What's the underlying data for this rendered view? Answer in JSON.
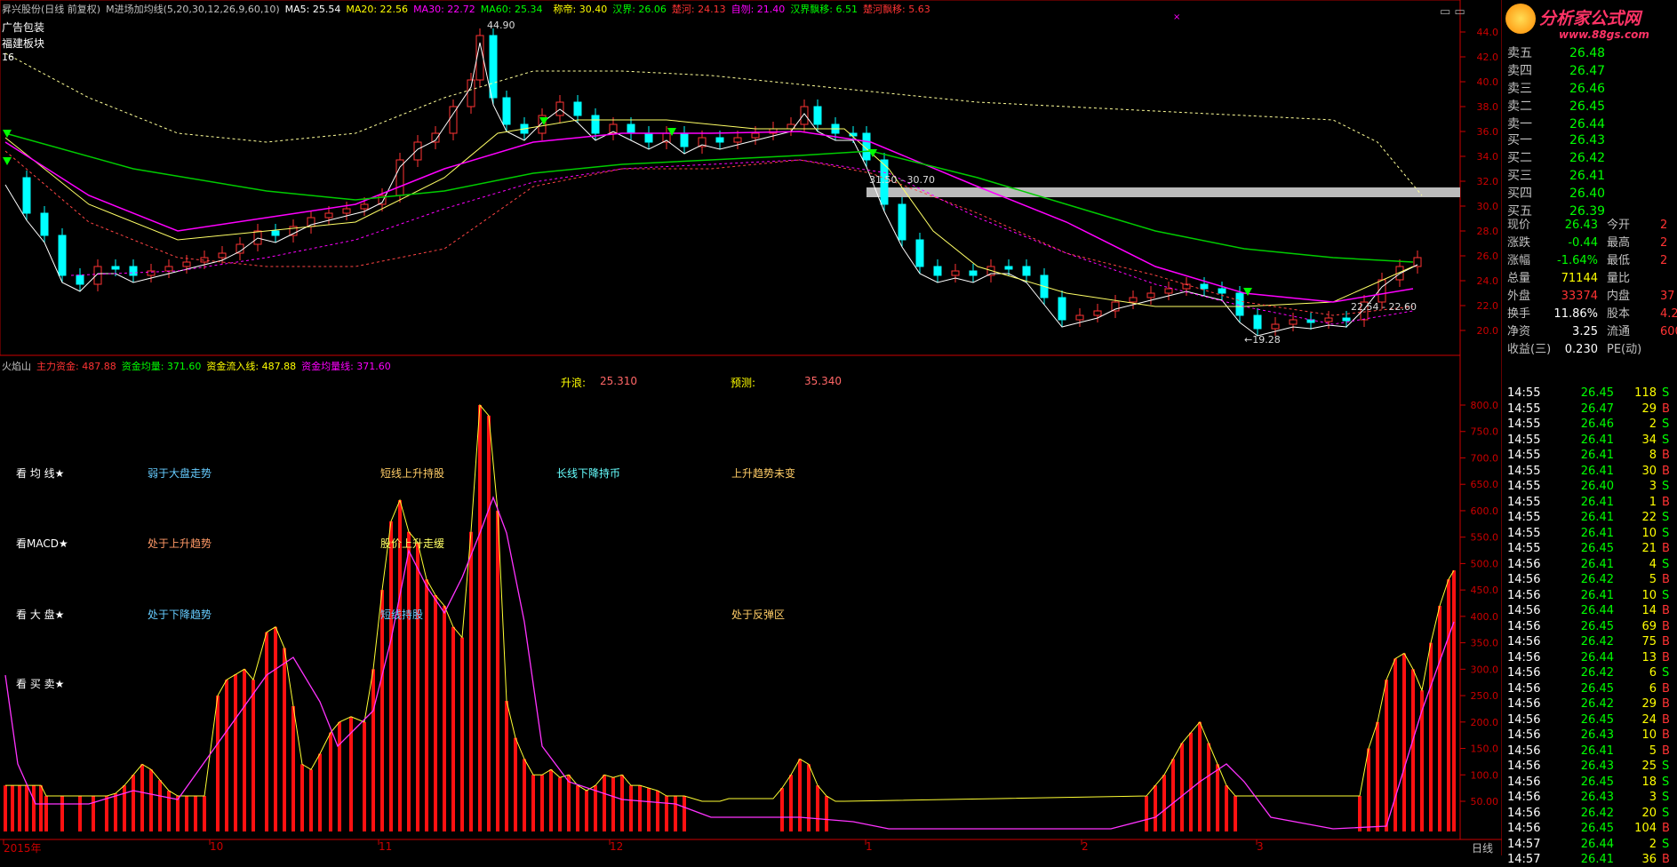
{
  "header": {
    "items": [
      {
        "text": "昇兴股份(日线 前复权)",
        "color": "#c0c0c0"
      },
      {
        "text": "M进场加均线(5,20,30,12,26,9,60,10)",
        "color": "#c0c0c0"
      },
      {
        "text": "MA5: 25.54",
        "color": "#ffffff"
      },
      {
        "text": "MA20: 22.56",
        "color": "#ffff00"
      },
      {
        "text": "MA30: 22.72",
        "color": "#ff00ff"
      },
      {
        "text": "MA60: 25.34",
        "color": "#00ff00"
      },
      {
        "text": "",
        "color": "#000"
      },
      {
        "text": "称帝: 30.40",
        "color": "#ffff00"
      },
      {
        "text": "汉界: 26.06",
        "color": "#00ff00"
      },
      {
        "text": "楚河: 24.13",
        "color": "#ff3333"
      },
      {
        "text": "自刎: 21.40",
        "color": "#ff00ff"
      },
      {
        "text": "汉界飘移: 6.51",
        "color": "#00ff00"
      },
      {
        "text": "楚河飘移: 5.63",
        "color": "#ff3333"
      }
    ]
  },
  "side_labels": {
    "ad": "广告包装",
    "sector": "福建板块",
    "num": "16"
  },
  "price_axis": [
    "44.0",
    "42.0",
    "40.0",
    "38.0",
    "36.0",
    "34.0",
    "32.0",
    "30.0",
    "28.0",
    "26.0",
    "24.0",
    "22.0",
    "20.0"
  ],
  "price_annotations": {
    "high": "44.90",
    "low": "←19.28",
    "band": "31.50 - 30.70",
    "band2": "22.54 - 22.60"
  },
  "lower_header": {
    "items": [
      {
        "text": "火焰山",
        "color": "#c0c0c0"
      },
      {
        "text": "主力资金: 487.88",
        "color": "#ff3333"
      },
      {
        "text": "资金均量: 371.60",
        "color": "#00ff00"
      },
      {
        "text": "资金流入线: 487.88",
        "color": "#ffff00"
      },
      {
        "text": "资金均量线: 371.60",
        "color": "#ff00ff"
      }
    ]
  },
  "lower_notes": {
    "up": "升浪:",
    "up_val": "25.310",
    "pred": "预测:",
    "pred_val": "35.340",
    "rows": [
      {
        "head": "看 均 线★",
        "a": "弱于大盘走势",
        "b": "短线上升持股",
        "c": "长线下降持币",
        "d": "上升趋势未变"
      },
      {
        "head": "看MACD★",
        "a": "处于上升趋势",
        "b": "股价上升走缓",
        "c": "",
        "d": ""
      },
      {
        "head": "看 大 盘★",
        "a": "处于下降趋势",
        "b": "短线持股",
        "c": "",
        "d": "处于反弹区"
      },
      {
        "head": "看 买 卖★",
        "a": "",
        "b": "",
        "c": "",
        "d": ""
      }
    ]
  },
  "lower_axis": [
    "800.0",
    "750.0",
    "700.0",
    "650.0",
    "600.0",
    "550.0",
    "500.0",
    "450.0",
    "400.0",
    "350.0",
    "300.0",
    "250.0",
    "200.0",
    "150.0",
    "100.0",
    "50.00"
  ],
  "date_axis": {
    "labels": [
      "2015年",
      "10",
      "11",
      "12",
      "1",
      "2",
      "3"
    ],
    "period": "日线"
  },
  "brand": {
    "name": "分析家公式网",
    "url": "www.88gs.com"
  },
  "order_book": {
    "asks": [
      {
        "label": "卖五",
        "price": "26.48"
      },
      {
        "label": "卖四",
        "price": "26.47"
      },
      {
        "label": "卖三",
        "price": "26.46"
      },
      {
        "label": "卖二",
        "price": "26.45"
      },
      {
        "label": "卖一",
        "price": "26.44"
      }
    ],
    "bids": [
      {
        "label": "买一",
        "price": "26.43"
      },
      {
        "label": "买二",
        "price": "26.42"
      },
      {
        "label": "买三",
        "price": "26.41"
      },
      {
        "label": "买四",
        "price": "26.40"
      },
      {
        "label": "买五",
        "price": "26.39"
      }
    ]
  },
  "quote_stats": [
    {
      "l1": "现价",
      "v1": "26.43",
      "c1": "#00ff00",
      "l2": "今开",
      "v2": "2"
    },
    {
      "l1": "涨跌",
      "v1": "-0.44",
      "c1": "#00ff00",
      "l2": "最高",
      "v2": "2"
    },
    {
      "l1": "涨幅",
      "v1": "-1.64%",
      "c1": "#00ff00",
      "l2": "最低",
      "v2": "2"
    },
    {
      "l1": "总量",
      "v1": "71144",
      "c1": "#ffff00",
      "l2": "量比",
      "v2": ""
    },
    {
      "l1": "外盘",
      "v1": "33374",
      "c1": "#ff3333",
      "l2": "内盘",
      "v2": "37"
    },
    {
      "l1": "换手",
      "v1": "11.86%",
      "c1": "#ffffff",
      "l2": "股本",
      "v2": "4.2"
    },
    {
      "l1": "净资",
      "v1": "3.25",
      "c1": "#ffffff",
      "l2": "流通",
      "v2": "600"
    },
    {
      "l1": "收益(三)",
      "v1": "0.230",
      "c1": "#ffffff",
      "l2": "PE(动)",
      "v2": ""
    }
  ],
  "ticks": [
    {
      "t": "14:55",
      "p": "26.45",
      "pc": "#00ff00",
      "v": "118",
      "bs": "S"
    },
    {
      "t": "14:55",
      "p": "26.47",
      "pc": "#00ff00",
      "v": "29",
      "bs": "B"
    },
    {
      "t": "14:55",
      "p": "26.46",
      "pc": "#00ff00",
      "v": "2",
      "bs": "S"
    },
    {
      "t": "14:55",
      "p": "26.41",
      "pc": "#00ff00",
      "v": "34",
      "bs": "S"
    },
    {
      "t": "14:55",
      "p": "26.41",
      "pc": "#00ff00",
      "v": "8",
      "bs": "B"
    },
    {
      "t": "14:55",
      "p": "26.41",
      "pc": "#00ff00",
      "v": "30",
      "bs": "B"
    },
    {
      "t": "14:55",
      "p": "26.40",
      "pc": "#00ff00",
      "v": "3",
      "bs": "S"
    },
    {
      "t": "14:55",
      "p": "26.41",
      "pc": "#00ff00",
      "v": "1",
      "bs": "B"
    },
    {
      "t": "14:55",
      "p": "26.41",
      "pc": "#00ff00",
      "v": "22",
      "bs": "S"
    },
    {
      "t": "14:55",
      "p": "26.41",
      "pc": "#00ff00",
      "v": "10",
      "bs": "S"
    },
    {
      "t": "14:55",
      "p": "26.45",
      "pc": "#00ff00",
      "v": "21",
      "bs": "B"
    },
    {
      "t": "14:56",
      "p": "26.41",
      "pc": "#00ff00",
      "v": "4",
      "bs": "S"
    },
    {
      "t": "14:56",
      "p": "26.42",
      "pc": "#00ff00",
      "v": "5",
      "bs": "B"
    },
    {
      "t": "14:56",
      "p": "26.41",
      "pc": "#00ff00",
      "v": "10",
      "bs": "S"
    },
    {
      "t": "14:56",
      "p": "26.44",
      "pc": "#00ff00",
      "v": "14",
      "bs": "B"
    },
    {
      "t": "14:56",
      "p": "26.45",
      "pc": "#00ff00",
      "v": "69",
      "bs": "B"
    },
    {
      "t": "14:56",
      "p": "26.42",
      "pc": "#00ff00",
      "v": "75",
      "bs": "B"
    },
    {
      "t": "14:56",
      "p": "26.44",
      "pc": "#00ff00",
      "v": "13",
      "bs": "B"
    },
    {
      "t": "14:56",
      "p": "26.42",
      "pc": "#00ff00",
      "v": "6",
      "bs": "S"
    },
    {
      "t": "14:56",
      "p": "26.45",
      "pc": "#00ff00",
      "v": "6",
      "bs": "B"
    },
    {
      "t": "14:56",
      "p": "26.42",
      "pc": "#00ff00",
      "v": "29",
      "bs": "B"
    },
    {
      "t": "14:56",
      "p": "26.45",
      "pc": "#00ff00",
      "v": "24",
      "bs": "B"
    },
    {
      "t": "14:56",
      "p": "26.43",
      "pc": "#00ff00",
      "v": "10",
      "bs": "B"
    },
    {
      "t": "14:56",
      "p": "26.41",
      "pc": "#00ff00",
      "v": "5",
      "bs": "B"
    },
    {
      "t": "14:56",
      "p": "26.43",
      "pc": "#00ff00",
      "v": "25",
      "bs": "S"
    },
    {
      "t": "14:56",
      "p": "26.45",
      "pc": "#00ff00",
      "v": "18",
      "bs": "S"
    },
    {
      "t": "14:56",
      "p": "26.43",
      "pc": "#00ff00",
      "v": "3",
      "bs": "S"
    },
    {
      "t": "14:56",
      "p": "26.42",
      "pc": "#00ff00",
      "v": "20",
      "bs": "S"
    },
    {
      "t": "14:56",
      "p": "26.45",
      "pc": "#00ff00",
      "v": "104",
      "bs": "B"
    },
    {
      "t": "14:57",
      "p": "26.44",
      "pc": "#00ff00",
      "v": "2",
      "bs": "S"
    },
    {
      "t": "14:57",
      "p": "26.41",
      "pc": "#00ff00",
      "v": "36",
      "bs": "B"
    }
  ]
}
